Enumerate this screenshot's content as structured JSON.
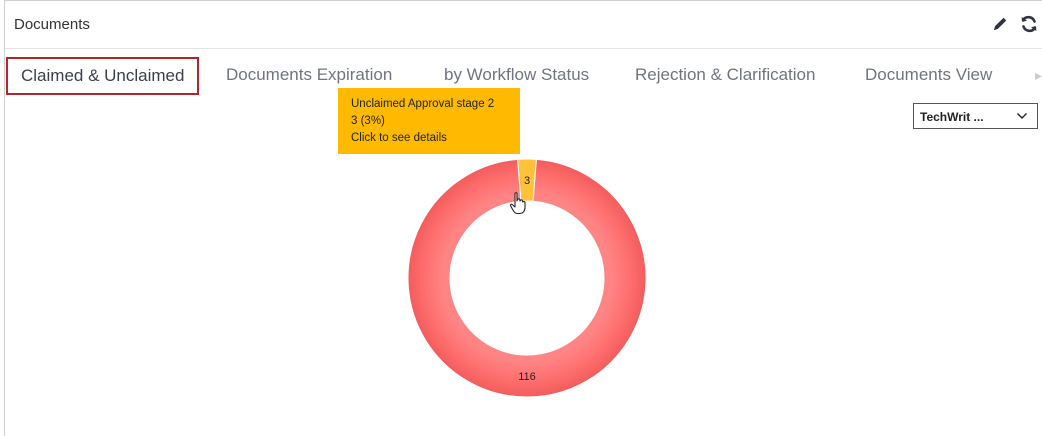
{
  "header": {
    "title": "Documents",
    "actions": [
      {
        "name": "edit",
        "icon": "pencil-icon"
      },
      {
        "name": "refresh",
        "icon": "refresh-icon"
      }
    ]
  },
  "tabs": [
    {
      "label": "Claimed & Unclaimed",
      "active": true
    },
    {
      "label": "Documents Expiration",
      "active": false
    },
    {
      "label": "by Workflow Status",
      "active": false
    },
    {
      "label": "Rejection & Clarification",
      "active": false
    },
    {
      "label": "Documents View",
      "active": false
    }
  ],
  "filter": {
    "selected": "TechWrit ..."
  },
  "tooltip": {
    "line1": "Unclaimed Approval stage 2",
    "line2": "3 (3%)",
    "line3": "Click to see details"
  },
  "colors": {
    "accent_border": "#b5232b",
    "slice_main": "#ff6f6f",
    "slice_highlight": "#ffc23a",
    "tooltip_bg": "#ffba00"
  },
  "chart_data": {
    "type": "pie",
    "variant": "donut",
    "slices": [
      {
        "value": 3,
        "label": "3",
        "color": "#ffc23a"
      },
      {
        "value": 116,
        "label": "116",
        "color": "#ff6f6f"
      }
    ]
  }
}
